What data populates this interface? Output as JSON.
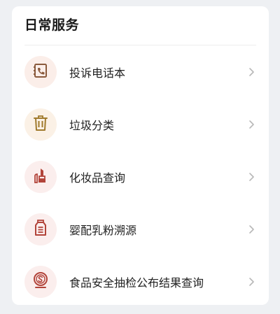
{
  "section": {
    "title": "日常服务"
  },
  "items": [
    {
      "label": "投诉电话本",
      "icon": "phonebook-icon",
      "bg": "#fbeee9",
      "color": "#8a5a3c"
    },
    {
      "label": "垃圾分类",
      "icon": "trash-bin-icon",
      "bg": "#fbf1e6",
      "color": "#a07a2c"
    },
    {
      "label": "化妆品查询",
      "icon": "lipstick-icon",
      "bg": "#fbeeed",
      "color": "#b2443a"
    },
    {
      "label": "婴配乳粉溯源",
      "icon": "milk-powder-icon",
      "bg": "#fbeeed",
      "color": "#b2443a"
    },
    {
      "label": "食品安全抽检公布结果查询",
      "icon": "food-safety-seal-icon",
      "bg": "#fbeeed",
      "color": "#b2443a"
    }
  ],
  "colors": {
    "chevron": "#b8b8b8",
    "background": "#eef0f3",
    "card": "#ffffff"
  }
}
